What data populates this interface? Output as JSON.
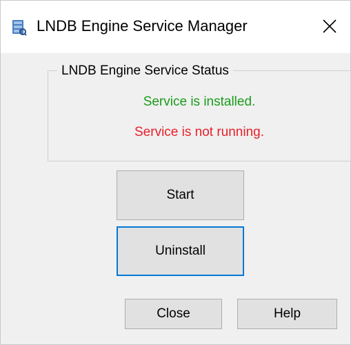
{
  "window": {
    "title": "LNDB Engine Service Manager",
    "app_icon": "database-tools-icon",
    "close_icon": "close-icon"
  },
  "status_group": {
    "legend": "LNDB Engine Service Status",
    "installed_text": "Service is installed.",
    "running_text": "Service is not running.",
    "installed_color": "#1a9b1a",
    "running_color": "#e8202a"
  },
  "buttons": {
    "start_label": "Start",
    "uninstall_label": "Uninstall",
    "close_label": "Close",
    "help_label": "Help"
  },
  "colors": {
    "focus_border": "#0078d7"
  }
}
